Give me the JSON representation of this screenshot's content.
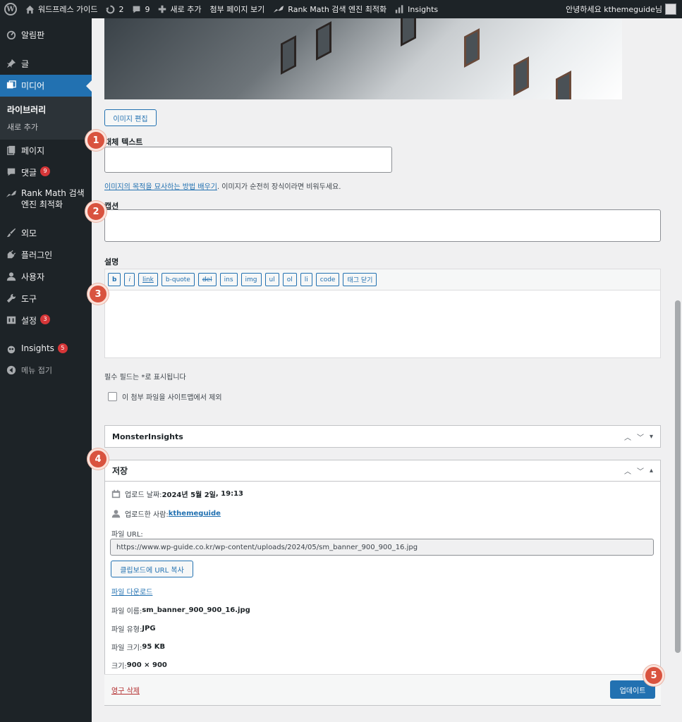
{
  "adminbar": {
    "site_name": "워드프레스 가이드",
    "updates_count": "2",
    "comments_count": "9",
    "new_label": "새로 추가",
    "view_attachment": "첨부 페이지 보기",
    "rankmath": "Rank Math 검색 엔진 최적화",
    "insights": "Insights",
    "greeting": "안녕하세요 kthemeguide님"
  },
  "sidebar": {
    "dashboard": "알림판",
    "posts": "글",
    "media": "미디어",
    "media_sub": [
      "라이브러리",
      "새로 추가"
    ],
    "pages": "페이지",
    "comments": "댓글",
    "comments_badge": "9",
    "rankmath_line1": "Rank Math 검색",
    "rankmath_line2": "엔진 최적화",
    "appearance": "외모",
    "plugins": "플러그인",
    "users": "사용자",
    "tools": "도구",
    "settings": "설정",
    "settings_badge": "3",
    "insights": "Insights",
    "insights_badge": "5",
    "collapse": "메뉴 접기"
  },
  "form": {
    "edit_image": "이미지 편집",
    "alt_label": "대체 텍스트",
    "alt_value": "",
    "alt_help_link": "이미지의 목적을 묘사하는 방법 배우기",
    "alt_help_text": ". 이미지가 순전히 장식이라면 비워두세요.",
    "caption_label": "캡션",
    "caption_value": "",
    "description_label": "설명",
    "quicktags": [
      "b",
      "i",
      "link",
      "b-quote",
      "del",
      "ins",
      "img",
      "ul",
      "ol",
      "li",
      "code",
      "태그 닫기"
    ],
    "description_value": "",
    "required_note": "필수 필드는 *로 표시됩니다",
    "sitemap_exclude": "이 첨부 파일을 사이트맵에서 제외"
  },
  "monsterinsights": {
    "title": "MonsterInsights"
  },
  "save_box": {
    "title": "저장",
    "uploaded_on_label": "업로드 날짜: ",
    "uploaded_on_value": "2024년 5월 2일",
    "uploaded_on_time": ", 19:13",
    "uploaded_by_label": "업로드한 사람: ",
    "uploaded_by_value": "kthemeguide",
    "file_url_label": "파일 URL:",
    "file_url": "https://www.wp-guide.co.kr/wp-content/uploads/2024/05/sm_banner_900_900_16.jpg",
    "copy_url": "클립보드에 URL 복사",
    "download": "파일 다운로드",
    "file_name_label": "파일 이름: ",
    "file_name": "sm_banner_900_900_16.jpg",
    "file_type_label": "파일 유형: ",
    "file_type": "JPG",
    "file_size_label": "파일 크기: ",
    "file_size": "95 KB",
    "dimensions_label": "크기: ",
    "dimensions": "900 × 900",
    "delete": "영구 삭제",
    "update": "업데이트"
  },
  "markers": [
    "1",
    "2",
    "3",
    "4",
    "5"
  ],
  "colors": {
    "primary": "#2271b1",
    "admin_dark": "#1d2327",
    "badge": "#d63638",
    "marker": "#d9533f",
    "delete": "#b32d2e"
  }
}
